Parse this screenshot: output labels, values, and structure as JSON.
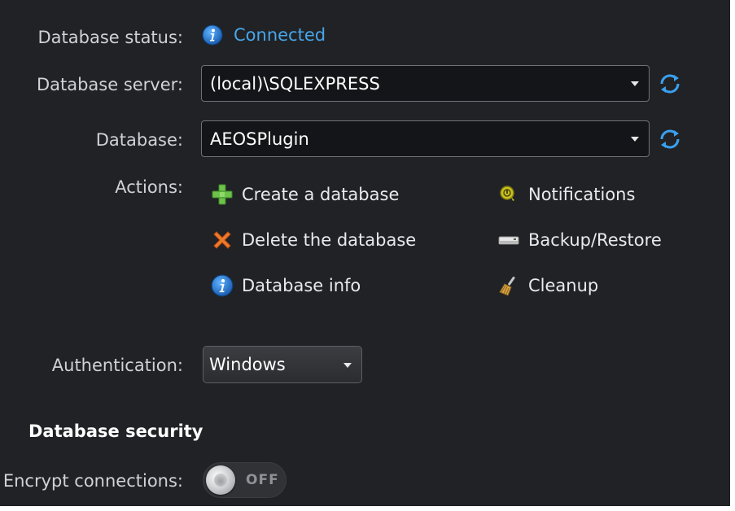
{
  "status": {
    "label": "Database status:",
    "value": "Connected",
    "icon": "info-icon",
    "value_color": "#47a6ea"
  },
  "server": {
    "label": "Database server:",
    "value": "(local)\\SQLEXPRESS",
    "refresh_icon": "refresh-icon"
  },
  "database": {
    "label": "Database:",
    "value": "AEOSPlugin",
    "refresh_icon": "refresh-icon"
  },
  "actions": {
    "label": "Actions:",
    "items": [
      {
        "label": "Create a database",
        "icon": "plus-icon"
      },
      {
        "label": "Delete the database",
        "icon": "x-icon"
      },
      {
        "label": "Database info",
        "icon": "info-icon"
      },
      {
        "label": "Notifications",
        "icon": "notification-icon"
      },
      {
        "label": "Backup/Restore",
        "icon": "backup-icon"
      },
      {
        "label": "Cleanup",
        "icon": "broom-icon"
      }
    ]
  },
  "authentication": {
    "label": "Authentication:",
    "value": "Windows"
  },
  "security": {
    "title": "Database security",
    "encrypt_label": "Encrypt connections:",
    "toggle_state": "OFF"
  }
}
